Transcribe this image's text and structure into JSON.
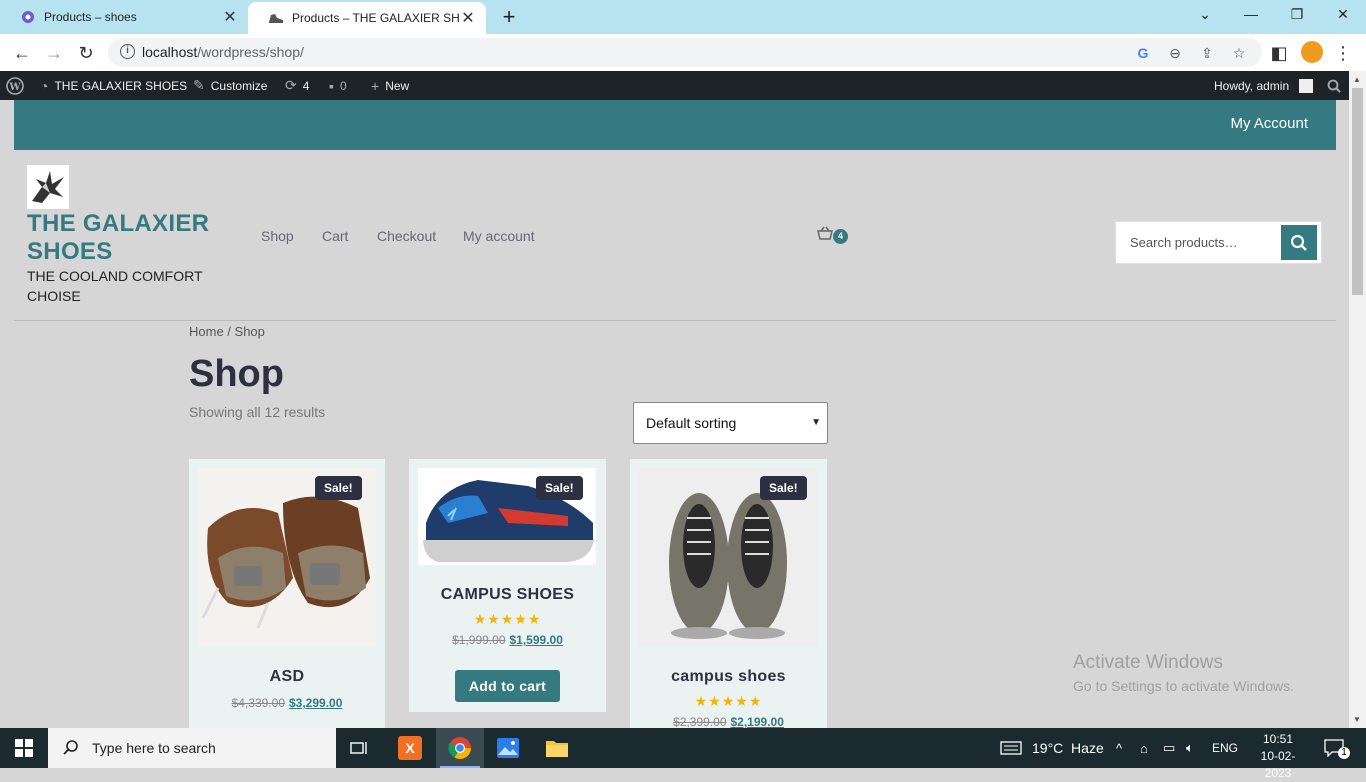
{
  "browser": {
    "tabs": [
      {
        "label": "Products – shoes",
        "active": false
      },
      {
        "label": "Products – THE GALAXIER SHOES",
        "active": true
      }
    ],
    "url_host": "localhost",
    "url_path": "/wordpress/shop/"
  },
  "wp_admin_bar": {
    "site_name": "THE GALAXIER SHOES",
    "customize": "Customize",
    "updates": "4",
    "comments": "0",
    "new": "New",
    "howdy": "Howdy, admin"
  },
  "site": {
    "my_account_top": "My Account",
    "title": "THE GALAXIER SHOES",
    "tagline": "THE COOLAND COMFORT CHOISE",
    "nav": [
      "Shop",
      "Cart",
      "Checkout",
      "My account"
    ],
    "cart_count": "4",
    "search_placeholder": "Search products…",
    "brand_color": "#347a80"
  },
  "breadcrumb": {
    "home": "Home",
    "sep": " / ",
    "current": "Shop"
  },
  "page": {
    "title": "Shop",
    "result_count": "Showing all 12 results",
    "sorting": "Default sorting"
  },
  "products": [
    {
      "sale": "Sale!",
      "name": "ASD",
      "old_price": "$4,339.00",
      "new_price": "$3,299.00"
    },
    {
      "sale": "Sale!",
      "name": "CAMPUS SHOES",
      "stars": "★★★★★",
      "old_price": "$1,999.00",
      "new_price": "$1,599.00",
      "button": "Add to cart"
    },
    {
      "sale": "Sale!",
      "name": "campus shoes",
      "stars": "★★★★★",
      "old_price": "$2,399.00",
      "new_price": "$2,199.00"
    }
  ],
  "watermark": {
    "line1": "Activate Windows",
    "line2": "Go to Settings to activate Windows."
  },
  "taskbar": {
    "search": "Type here to search",
    "weather": "19°C  Haze",
    "lang": "ENG",
    "time": "10:51",
    "date": "10-02-2023",
    "notifications": "1"
  }
}
